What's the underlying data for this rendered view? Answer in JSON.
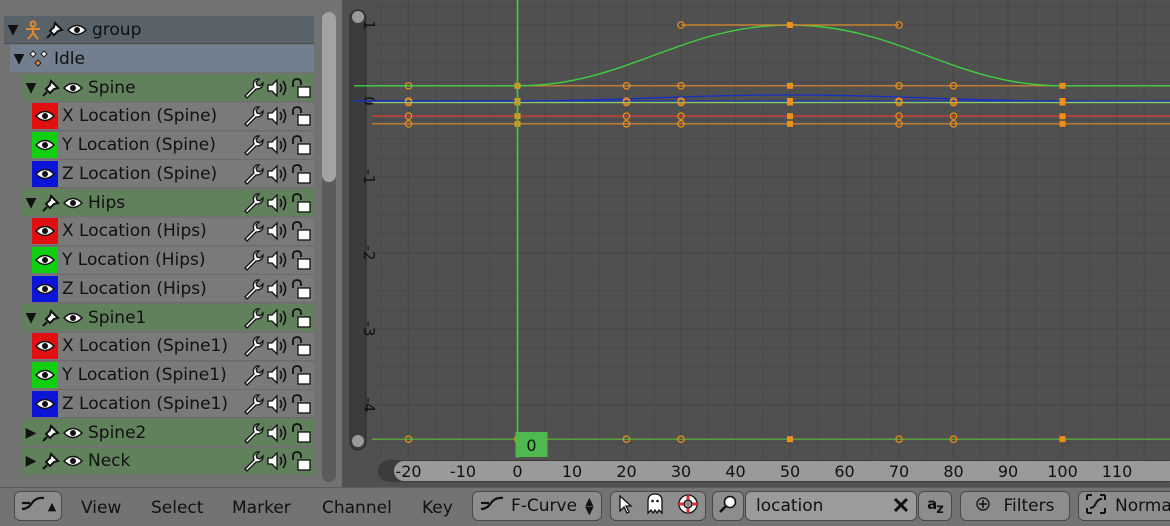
{
  "channels": {
    "group": {
      "label": "group"
    },
    "action": {
      "label": "Idle"
    },
    "rows": [
      {
        "kind": "bone",
        "label": "Spine",
        "expanded": true
      },
      {
        "kind": "curve",
        "label": "X Location (Spine)",
        "color": "#e01010"
      },
      {
        "kind": "curve",
        "label": "Y Location (Spine)",
        "color": "#10cf10"
      },
      {
        "kind": "curve",
        "label": "Z Location (Spine)",
        "color": "#0c14d8"
      },
      {
        "kind": "bone",
        "label": "Hips",
        "expanded": true
      },
      {
        "kind": "curve",
        "label": "X Location (Hips)",
        "color": "#e01010"
      },
      {
        "kind": "curve",
        "label": "Y Location (Hips)",
        "color": "#10cf10"
      },
      {
        "kind": "curve",
        "label": "Z Location (Hips)",
        "color": "#0c14d8"
      },
      {
        "kind": "bone",
        "label": "Spine1",
        "expanded": true
      },
      {
        "kind": "curve",
        "label": "X Location (Spine1)",
        "color": "#e01010"
      },
      {
        "kind": "curve",
        "label": "Y Location (Spine1)",
        "color": "#10cf10"
      },
      {
        "kind": "curve",
        "label": "Z Location (Spine1)",
        "color": "#0c14d8"
      },
      {
        "kind": "bone",
        "label": "Spine2",
        "expanded": false
      },
      {
        "kind": "bone",
        "label": "Neck",
        "expanded": false
      }
    ]
  },
  "graph": {
    "frame_ticks": [
      "-20",
      "-10",
      "0",
      "10",
      "20",
      "30",
      "40",
      "50",
      "60",
      "70",
      "80",
      "90",
      "100",
      "110"
    ],
    "value_ticks": [
      "1",
      "0",
      "-1",
      "-2",
      "-3",
      "-4"
    ],
    "current_frame": "0",
    "colors": {
      "background": "#505050",
      "grid": "#474747",
      "cursor": "#3fd03f",
      "flat_curve": "#e08a2c",
      "keyframe": "#f0901a"
    }
  },
  "footer": {
    "menus": [
      "View",
      "Select",
      "Marker",
      "Channel",
      "Key"
    ],
    "mode": "F-Curve",
    "search_value": "location",
    "filters_label": "Filters",
    "normalize_label": "Normal"
  }
}
